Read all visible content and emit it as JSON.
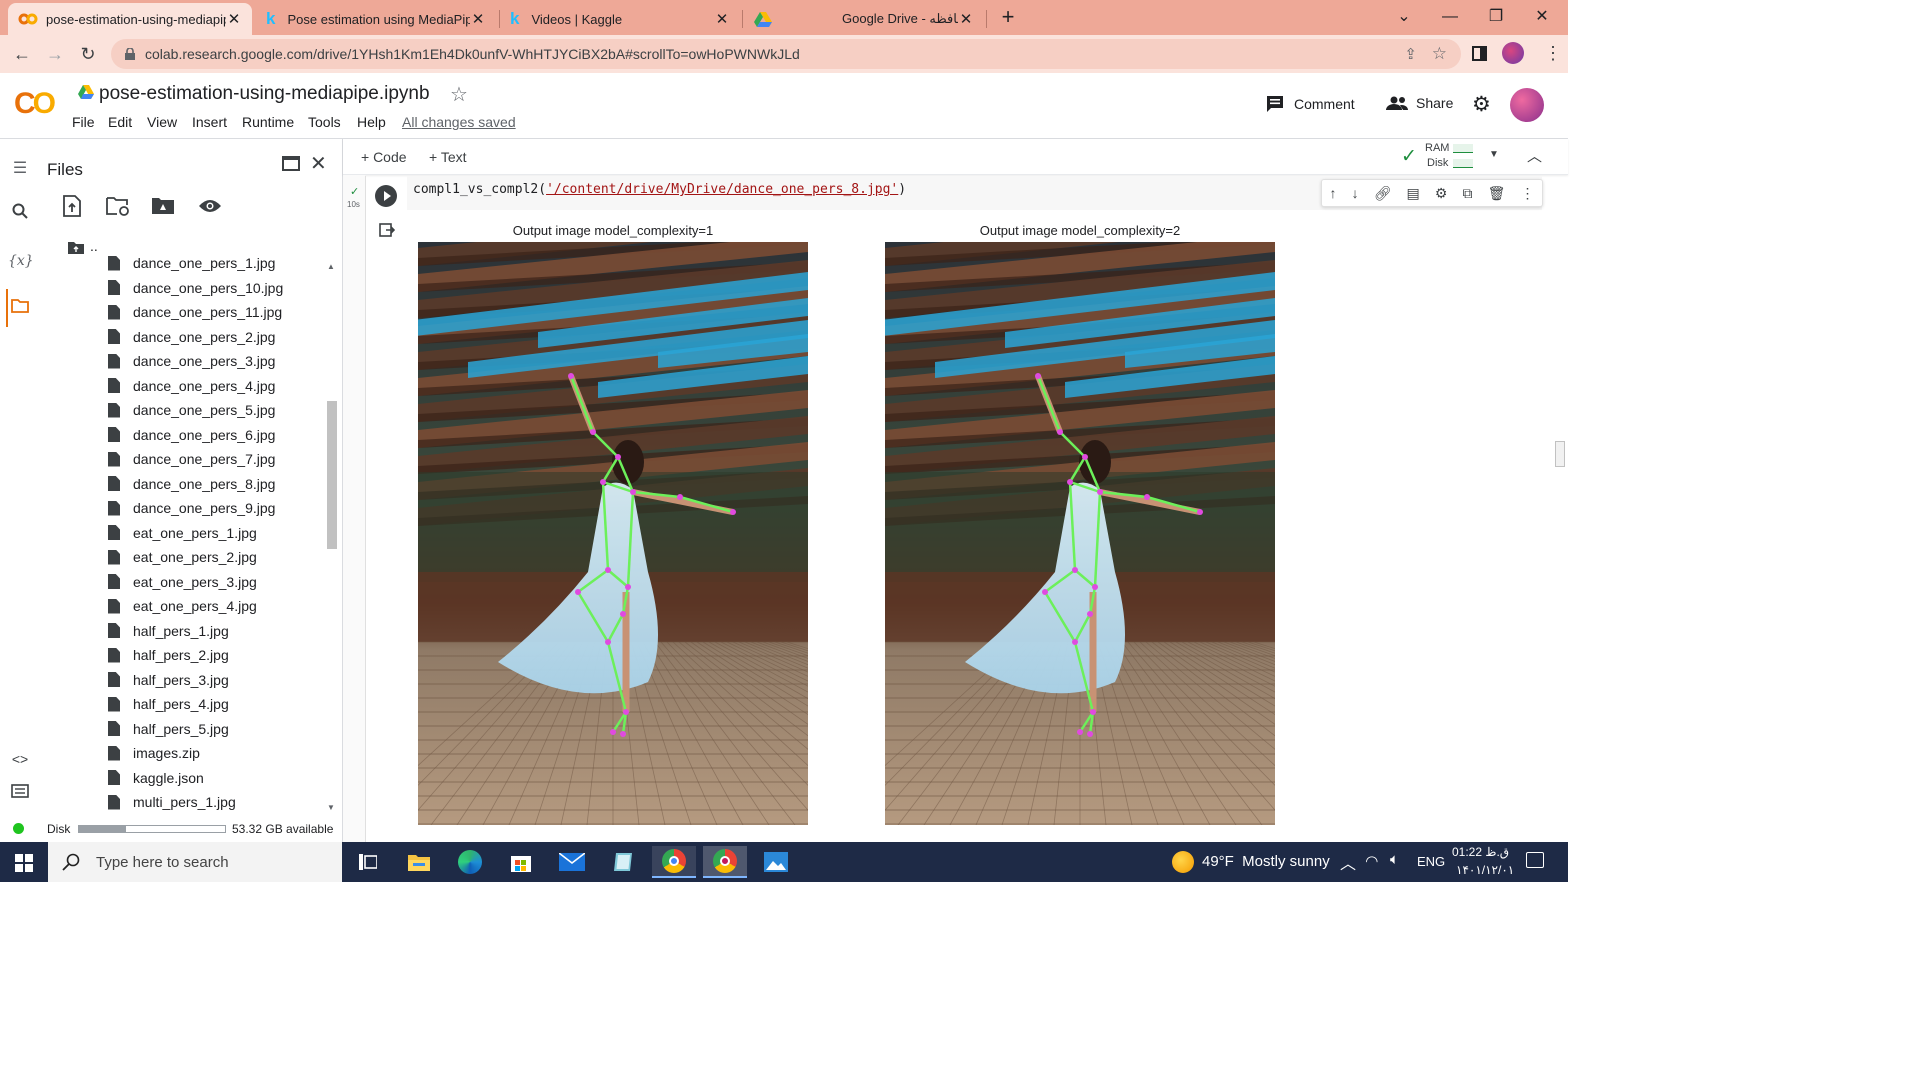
{
  "browser": {
    "tabs": [
      {
        "title": "pose-estimation-using-mediapip",
        "icon": "colab-icon",
        "active": true
      },
      {
        "title": "Pose estimation using MediaPipe",
        "icon": "kaggle-icon"
      },
      {
        "title": "Videos | Kaggle",
        "icon": "kaggle-icon"
      },
      {
        "title": "Google Drive - حافظه",
        "icon": "drive-icon"
      }
    ],
    "url": "colab.research.google.com/drive/1YHsh1Km1Eh4Dk0unfV-WhHTJYCiBX2bA#scrollTo=owHoPWNWkJLd"
  },
  "colab": {
    "logo": "CO",
    "notebook_title": "pose-estimation-using-mediapipe.ipynb",
    "menu": [
      "File",
      "Edit",
      "View",
      "Insert",
      "Runtime",
      "Tools",
      "Help"
    ],
    "save_status": "All changes saved",
    "comment_label": "Comment",
    "share_label": "Share",
    "add_code": "+ Code",
    "add_text": "+ Text",
    "ram_label": "RAM",
    "disk_label": "Disk"
  },
  "files_panel": {
    "title": "Files",
    "parent": "..",
    "items": [
      "dance_one_pers_1.jpg",
      "dance_one_pers_10.jpg",
      "dance_one_pers_11.jpg",
      "dance_one_pers_2.jpg",
      "dance_one_pers_3.jpg",
      "dance_one_pers_4.jpg",
      "dance_one_pers_5.jpg",
      "dance_one_pers_6.jpg",
      "dance_one_pers_7.jpg",
      "dance_one_pers_8.jpg",
      "dance_one_pers_9.jpg",
      "eat_one_pers_1.jpg",
      "eat_one_pers_2.jpg",
      "eat_one_pers_3.jpg",
      "eat_one_pers_4.jpg",
      "half_pers_1.jpg",
      "half_pers_2.jpg",
      "half_pers_3.jpg",
      "half_pers_4.jpg",
      "half_pers_5.jpg",
      "images.zip",
      "kaggle.json",
      "multi_pers_1.jpg"
    ],
    "disk_label": "Disk",
    "disk_available": "53.32 GB available",
    "disk_fraction": 0.32
  },
  "cell": {
    "exec_time": "10s",
    "code_prefix": "compl1_vs_compl2(",
    "code_arg": "'/content/drive/MyDrive/dance_one_pers_8.jpg'",
    "code_suffix": ")",
    "output_titles": [
      "Output image model_complexity=1",
      "Output image model_complexity=2"
    ]
  },
  "taskbar": {
    "search_placeholder": "Type here to search",
    "weather": "49°F  Mostly sunny",
    "lang": "ENG",
    "time": "01:22 ق.ظ",
    "date": "۱۴۰۱/۱۲/۰۱"
  },
  "colors": {
    "tabstrip": "#eea897",
    "toolbar": "#fbe3dc",
    "colab_orange": "#f9ab00",
    "colab_dark_orange": "#e8710a",
    "taskbar": "#1e2a46",
    "skeleton_line": "#6cf05a",
    "skeleton_joint": "#e04ae0"
  }
}
